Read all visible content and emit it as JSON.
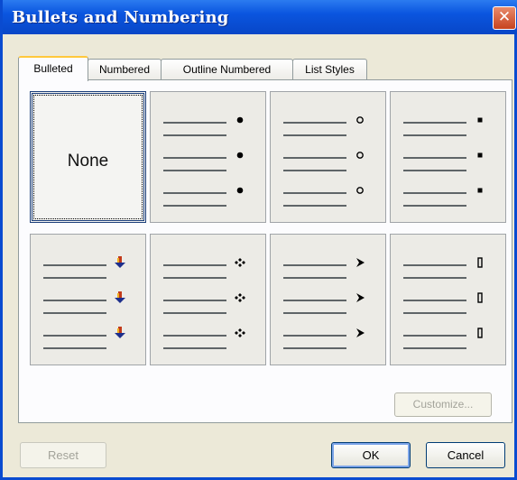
{
  "dialog": {
    "title": "Bullets and Numbering",
    "close_glyph": "✕"
  },
  "tabs": [
    {
      "label": "Bulleted",
      "active": true
    },
    {
      "label": "Numbered",
      "active": false
    },
    {
      "label": "Outline Numbered",
      "active": false
    },
    {
      "label": "List Styles",
      "active": false
    }
  ],
  "gallery": {
    "none_label": "None",
    "cells": [
      {
        "bullet": "none",
        "selected": true
      },
      {
        "bullet": "filled-circle",
        "icon": "filled-circle-bullet-icon"
      },
      {
        "bullet": "hollow-circle",
        "icon": "hollow-circle-bullet-icon"
      },
      {
        "bullet": "filled-square",
        "icon": "filled-square-bullet-icon"
      },
      {
        "bullet": "picture-arrow",
        "icon": "picture-bullet-icon"
      },
      {
        "bullet": "four-diamonds",
        "icon": "four-diamond-bullet-icon"
      },
      {
        "bullet": "arrowhead",
        "icon": "arrowhead-bullet-icon"
      },
      {
        "bullet": "bar",
        "icon": "bar-bullet-icon"
      }
    ]
  },
  "buttons": {
    "customize": "Customize...",
    "reset": "Reset",
    "ok": "OK",
    "cancel": "Cancel"
  },
  "colors": {
    "title_bar": "#0a55df",
    "close_button": "#c7431f",
    "active_tab_highlight": "#ffc83c",
    "cell_background": "#ecebe6",
    "selected_border": "#1c3f7a"
  }
}
